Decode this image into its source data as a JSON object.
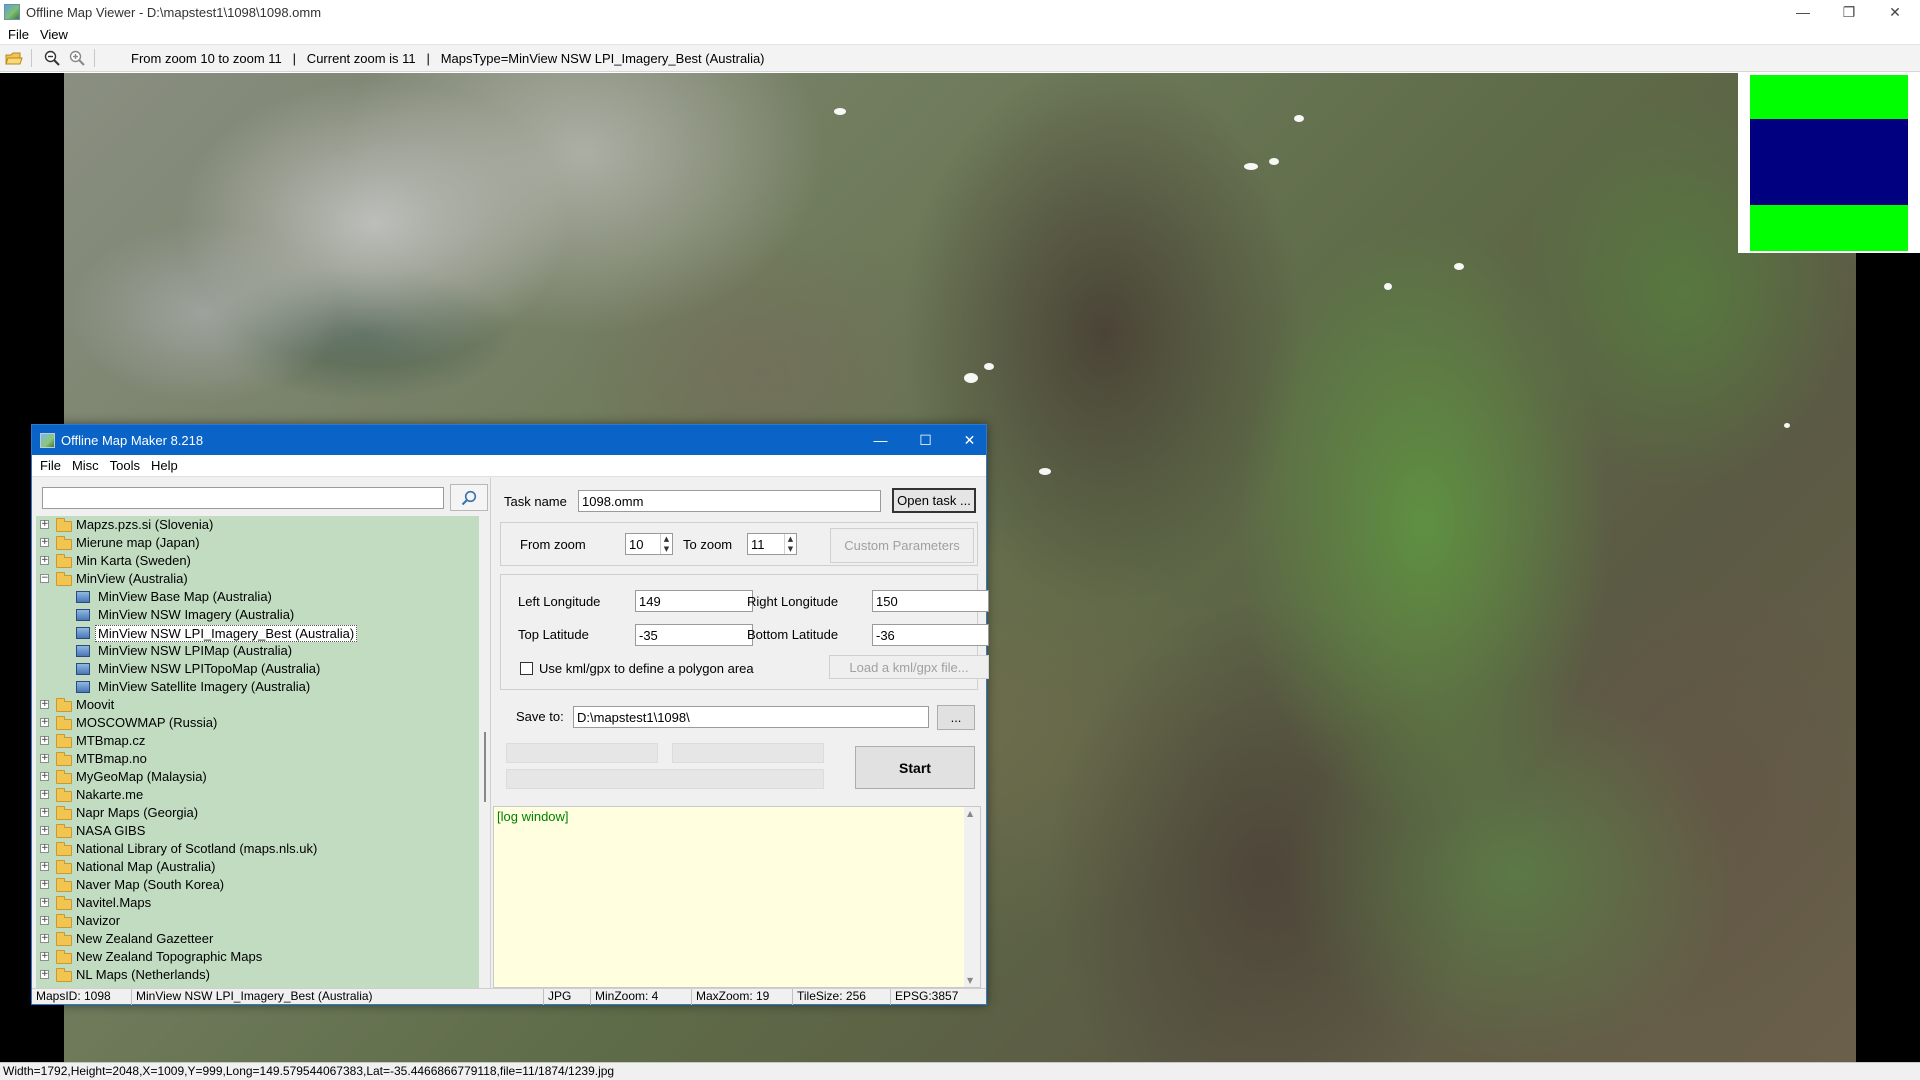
{
  "main_window": {
    "title": "Offline Map Viewer - D:\\mapstest1\\1098\\1098.omm",
    "menu": [
      "File",
      "View"
    ],
    "toolbar_info": "From zoom 10 to zoom 11   |   Current zoom is 11   |   MapsType=MinView NSW LPI_Imagery_Best (Australia)",
    "status": "Width=1792,Height=2048,X=1009,Y=999,Long=149.579544067383,Lat=-35.4466866779118,file=11/1874/1239.jpg",
    "overview_colors": {
      "frame": "#00ff00",
      "viewport": "#000080"
    }
  },
  "dialog": {
    "title": "Offline Map Maker 8.218",
    "menu": [
      "File",
      "Misc",
      "Tools",
      "Help"
    ],
    "search": {
      "value": ""
    },
    "tree": [
      {
        "label": "Mapzs.pzs.si (Slovenia)",
        "type": "folder",
        "expanded": false
      },
      {
        "label": "Mierune map (Japan)",
        "type": "folder",
        "expanded": false
      },
      {
        "label": "Min Karta (Sweden)",
        "type": "folder",
        "expanded": false
      },
      {
        "label": "MinView (Australia)",
        "type": "folder",
        "expanded": true
      },
      {
        "label": "MinView Base Map (Australia)",
        "type": "map"
      },
      {
        "label": "MinView NSW Imagery (Australia)",
        "type": "map"
      },
      {
        "label": "MinView NSW LPI_Imagery_Best (Australia)",
        "type": "map",
        "selected": true
      },
      {
        "label": "MinView NSW LPIMap (Australia)",
        "type": "map"
      },
      {
        "label": "MinView NSW LPITopoMap (Australia)",
        "type": "map"
      },
      {
        "label": "MinView Satellite Imagery (Australia)",
        "type": "map"
      },
      {
        "label": "Moovit",
        "type": "folder",
        "expanded": false
      },
      {
        "label": "MOSCOWMAP (Russia)",
        "type": "folder",
        "expanded": false
      },
      {
        "label": "MTBmap.cz",
        "type": "folder",
        "expanded": false
      },
      {
        "label": "MTBmap.no",
        "type": "folder",
        "expanded": false
      },
      {
        "label": "MyGeoMap (Malaysia)",
        "type": "folder",
        "expanded": false
      },
      {
        "label": "Nakarte.me",
        "type": "folder",
        "expanded": false
      },
      {
        "label": "Napr Maps (Georgia)",
        "type": "folder",
        "expanded": false
      },
      {
        "label": "NASA GIBS",
        "type": "folder",
        "expanded": false
      },
      {
        "label": "National Library of Scotland (maps.nls.uk)",
        "type": "folder",
        "expanded": false
      },
      {
        "label": "National Map (Australia)",
        "type": "folder",
        "expanded": false
      },
      {
        "label": "Naver Map (South Korea)",
        "type": "folder",
        "expanded": false
      },
      {
        "label": "Navitel.Maps",
        "type": "folder",
        "expanded": false
      },
      {
        "label": "Navizor",
        "type": "folder",
        "expanded": false
      },
      {
        "label": "New Zealand Gazetteer",
        "type": "folder",
        "expanded": false
      },
      {
        "label": "New Zealand Topographic Maps",
        "type": "folder",
        "expanded": false
      },
      {
        "label": "NL Maps (Netherlands)",
        "type": "folder",
        "expanded": false
      }
    ],
    "task": {
      "task_name_label": "Task name",
      "task_name_value": "1098.omm",
      "open_task_label": "Open task ...",
      "from_zoom_label": "From zoom",
      "from_zoom_value": "10",
      "to_zoom_label": "To zoom",
      "to_zoom_value": "11",
      "custom_params_label": "Custom Parameters",
      "left_long_label": "Left Longitude",
      "left_long_value": "149",
      "right_long_label": "Right Longitude",
      "right_long_value": "150",
      "top_lat_label": "Top Latitude",
      "top_lat_value": "-35",
      "bottom_lat_label": "Bottom Latitude",
      "bottom_lat_value": "-36",
      "kml_checkbox_label": "Use kml/gpx to define a polygon area",
      "kml_checked": false,
      "load_kml_label": "Load a kml/gpx file...",
      "save_to_label": "Save to:",
      "save_to_value": "D:\\mapstest1\\1098\\",
      "browse_label": "...",
      "start_label": "Start"
    },
    "log_text": "[log window]",
    "status": {
      "maps_id": "MapsID: 1098",
      "map_name": "MinView NSW LPI_Imagery_Best (Australia)",
      "format": "JPG",
      "min_zoom": "MinZoom: 4",
      "max_zoom": "MaxZoom: 19",
      "tile_size": "TileSize: 256",
      "epsg": "EPSG:3857"
    }
  }
}
